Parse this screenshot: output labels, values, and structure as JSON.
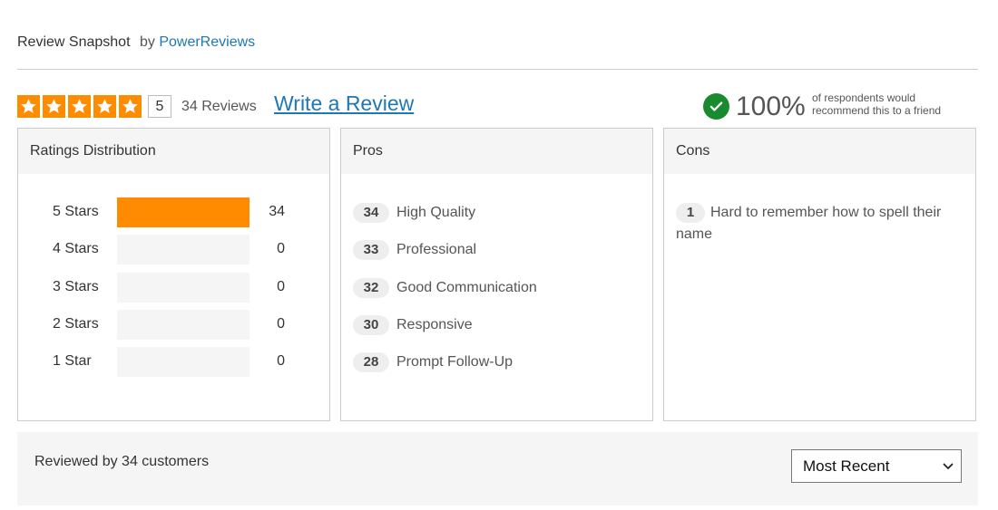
{
  "header": {
    "title": "Review Snapshot",
    "by": "by",
    "brand": "PowerReviews"
  },
  "summary": {
    "rating": "5",
    "stars": 5,
    "review_count": "34 Reviews",
    "write_review": "Write a Review",
    "recommend_pct": "100%",
    "recommend_text": "of respondents would recommend this to a friend"
  },
  "distribution": {
    "heading": "Ratings Distribution",
    "rows": [
      {
        "label": "5 Stars",
        "count": "34",
        "fraction": 1.0
      },
      {
        "label": "4 Stars",
        "count": "0",
        "fraction": 0
      },
      {
        "label": "3 Stars",
        "count": "0",
        "fraction": 0
      },
      {
        "label": "2 Stars",
        "count": "0",
        "fraction": 0
      },
      {
        "label": "1 Star",
        "count": "0",
        "fraction": 0
      }
    ]
  },
  "pros": {
    "heading": "Pros",
    "items": [
      {
        "count": "34",
        "label": "High Quality"
      },
      {
        "count": "33",
        "label": "Professional"
      },
      {
        "count": "32",
        "label": "Good Communication"
      },
      {
        "count": "30",
        "label": "Responsive"
      },
      {
        "count": "28",
        "label": "Prompt Follow-Up"
      }
    ]
  },
  "cons": {
    "heading": "Cons",
    "items": [
      {
        "count": "1",
        "label": "Hard to remember how to spell their name"
      }
    ]
  },
  "footer": {
    "reviewed_by": "Reviewed by 34 customers",
    "sort_selected": "Most Recent"
  },
  "colors": {
    "accent": "#ff8c00",
    "link": "#1f78b4",
    "check": "#1a8a2f",
    "panel_bg": "#f5f5f5"
  },
  "icons": {
    "star": "star-icon",
    "check": "check-circle-icon",
    "chevron": "chevron-down-icon"
  }
}
